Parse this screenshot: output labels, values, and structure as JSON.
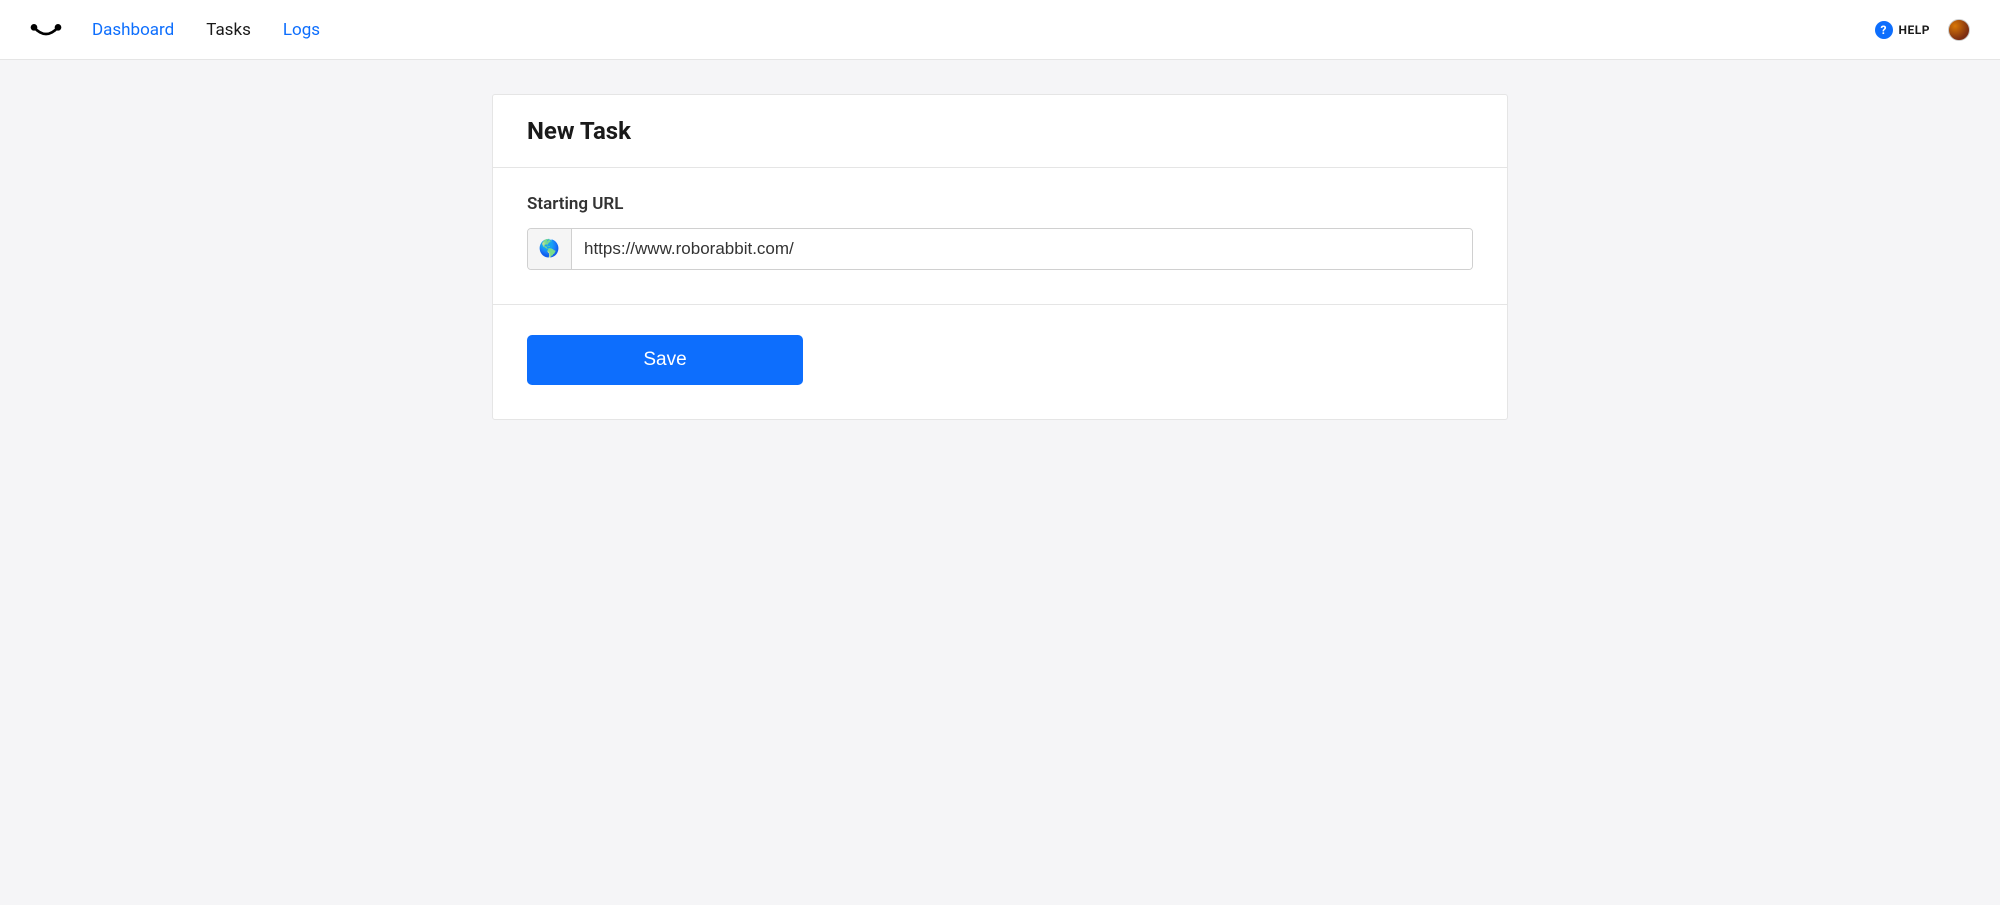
{
  "nav": {
    "dashboard": "Dashboard",
    "tasks": "Tasks",
    "logs": "Logs"
  },
  "header": {
    "help_label": "HELP"
  },
  "page": {
    "title": "New Task",
    "url_label": "Starting URL",
    "url_value": "https://www.roborabbit.com/",
    "globe_icon": "🌎",
    "save_label": "Save"
  }
}
